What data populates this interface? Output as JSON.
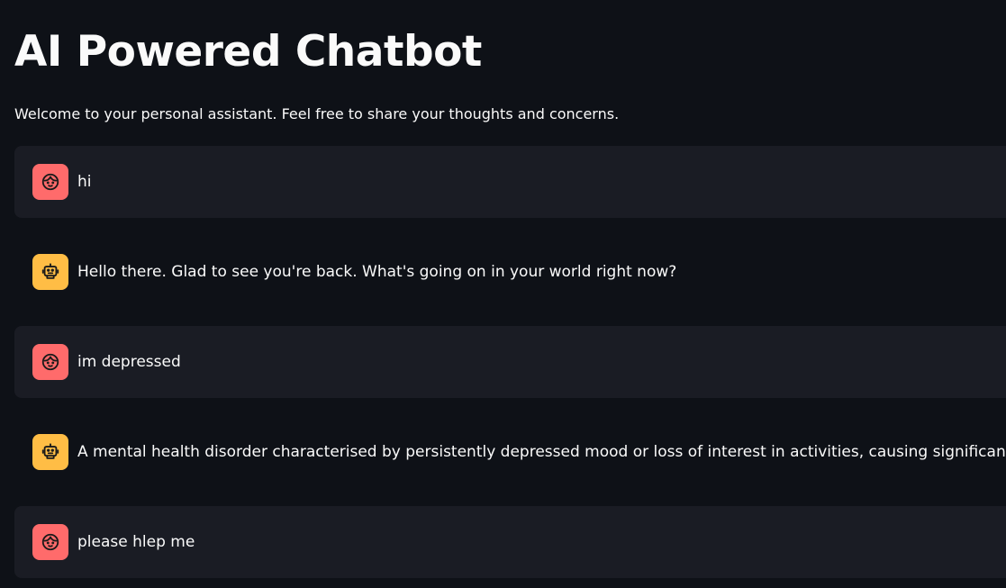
{
  "header": {
    "title": "AI Powered Chatbot",
    "subtitle": "Welcome to your personal assistant. Feel free to share your thoughts and concerns."
  },
  "colors": {
    "background": "#0e1117",
    "user_message_bg": "#1a1c24",
    "user_avatar": "#ff6b6b",
    "assistant_avatar": "#ffbd45",
    "text": "#fafafa"
  },
  "messages": [
    {
      "role": "user",
      "avatar_icon": "face-icon",
      "text": "hi"
    },
    {
      "role": "assistant",
      "avatar_icon": "robot-icon",
      "text": "Hello there. Glad to see you're back. What's going on in your world right now?"
    },
    {
      "role": "user",
      "avatar_icon": "face-icon",
      "text": "im depressed"
    },
    {
      "role": "assistant",
      "avatar_icon": "robot-icon",
      "text": "A mental health disorder characterised by persistently depressed mood or loss of interest in activities, causing significant impairment in daily life."
    },
    {
      "role": "user",
      "avatar_icon": "face-icon",
      "text": "please hlep me"
    }
  ]
}
